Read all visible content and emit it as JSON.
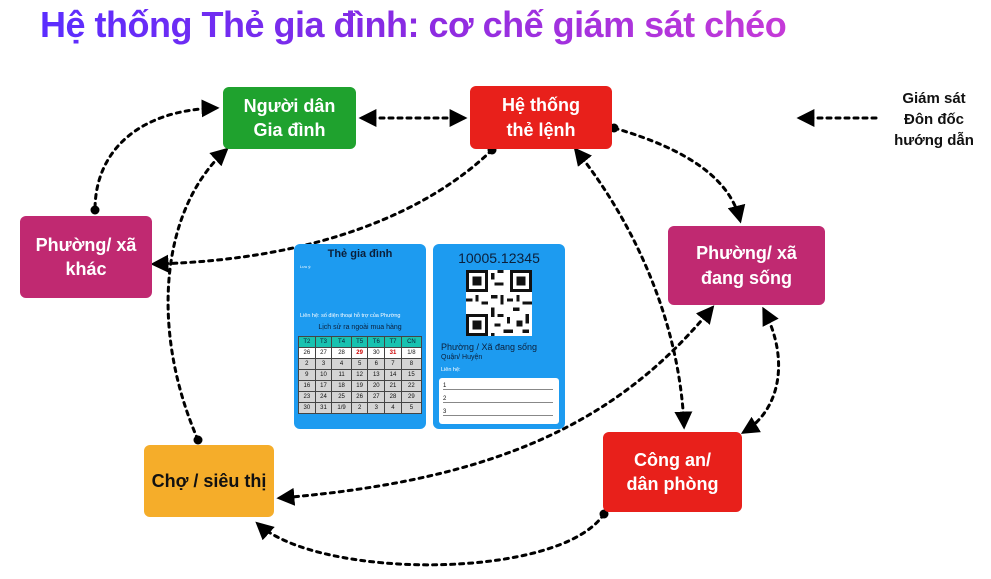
{
  "title": "Hệ thống Thẻ gia đình: cơ chế giám sát chéo",
  "nodes": {
    "nguoi_dan": {
      "line1": "Người dân",
      "line2": "Gia đình"
    },
    "he_thong": {
      "line1": "Hệ thống",
      "line2": "thẻ lệnh"
    },
    "phuong_khac": {
      "line1": "Phường/ xã",
      "line2": "khác"
    },
    "phuong_dang_song": {
      "line1": "Phường/ xã",
      "line2": "đang sống"
    },
    "cong_an": {
      "line1": "Công an/",
      "line2": "dân phòng"
    },
    "cho": {
      "line1": "Chợ / siêu thị"
    }
  },
  "legend": {
    "line1": "Giám sát",
    "line2": "Đôn đốc",
    "line3": "hướng dẫn"
  },
  "colors": {
    "green": "#1fa22e",
    "red": "#e8201b",
    "magenta": "#c02971",
    "amber": "#f5ad2a",
    "card_blue": "#1d9bf0"
  },
  "card_front": {
    "title": "Thẻ gia đình",
    "notes_heading": "Lưu ý:",
    "lien_he": "Liên hệ: số điện thoại hỗ trợ của Phường",
    "history_title": "Lịch sử ra ngoài mua hàng",
    "calendar_header": [
      "T2",
      "T3",
      "T4",
      "T5",
      "T6",
      "T7",
      "CN"
    ],
    "calendar_rows": [
      [
        "26",
        "27",
        "28",
        "29",
        "30",
        "31",
        "1/8"
      ],
      [
        "2",
        "3",
        "4",
        "5",
        "6",
        "7",
        "8"
      ],
      [
        "9",
        "10",
        "11",
        "12",
        "13",
        "14",
        "15"
      ],
      [
        "16",
        "17",
        "18",
        "19",
        "20",
        "21",
        "22"
      ],
      [
        "23",
        "24",
        "25",
        "26",
        "27",
        "28",
        "29"
      ],
      [
        "30",
        "31",
        "1/9",
        "2",
        "3",
        "4",
        "5"
      ]
    ]
  },
  "card_back": {
    "code": "10005.12345",
    "location": "Phường / Xã đang sống",
    "district": "Quận/ Huyện",
    "lien_he": "Liên hệ:",
    "lines": [
      "1",
      "2",
      "3"
    ]
  }
}
